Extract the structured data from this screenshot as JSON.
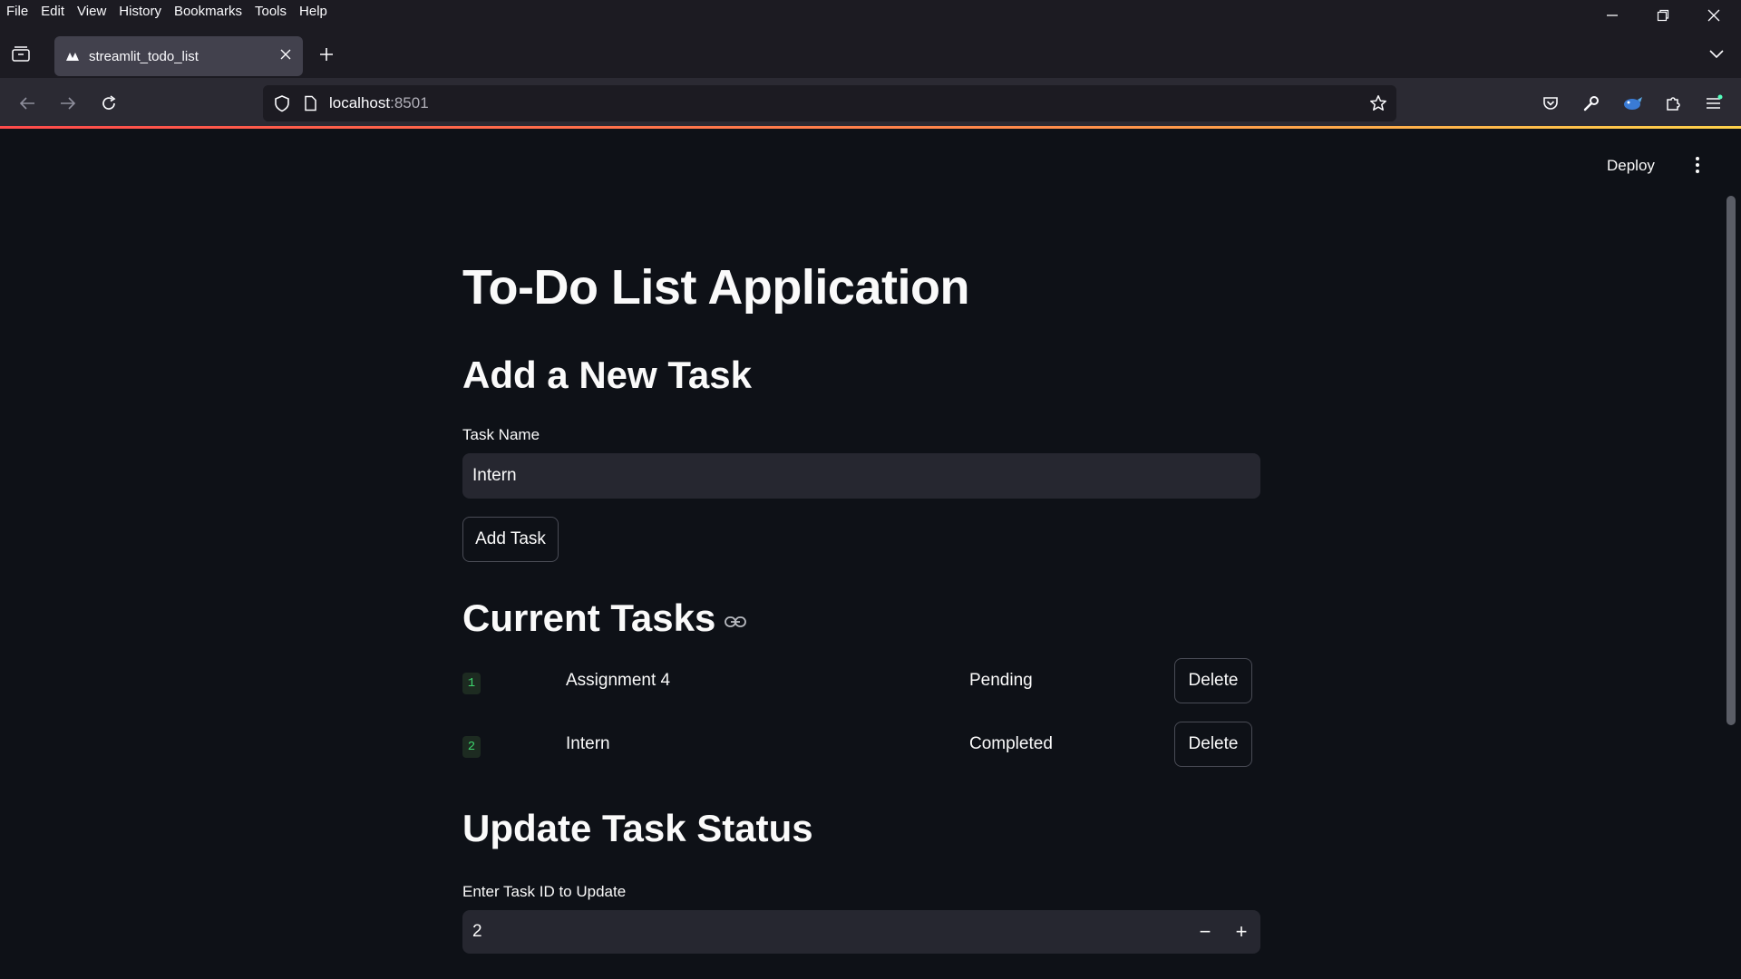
{
  "menubar": {
    "items": [
      "File",
      "Edit",
      "View",
      "History",
      "Bookmarks",
      "Tools",
      "Help"
    ]
  },
  "tab": {
    "title": "streamlit_todo_list"
  },
  "urlbar": {
    "host": "localhost",
    "port": ":8501"
  },
  "app": {
    "deploy_label": "Deploy",
    "title": "To-Do List Application",
    "add_section": {
      "heading": "Add a New Task",
      "task_name_label": "Task Name",
      "task_name_value": "Intern",
      "add_button": "Add Task"
    },
    "current_section": {
      "heading": "Current Tasks",
      "tasks": [
        {
          "id": "1",
          "name": "Assignment 4",
          "status": "Pending",
          "delete_label": "Delete"
        },
        {
          "id": "2",
          "name": "Intern",
          "status": "Completed",
          "delete_label": "Delete"
        }
      ]
    },
    "update_section": {
      "heading": "Update Task Status",
      "id_label": "Enter Task ID to Update",
      "id_value": "2",
      "minus": "−",
      "plus": "+"
    }
  },
  "colors": {
    "background": "#0e1117",
    "input_bg": "#262730",
    "id_badge_fg": "#3dd56d",
    "accent_line": "#ff4b4b"
  }
}
